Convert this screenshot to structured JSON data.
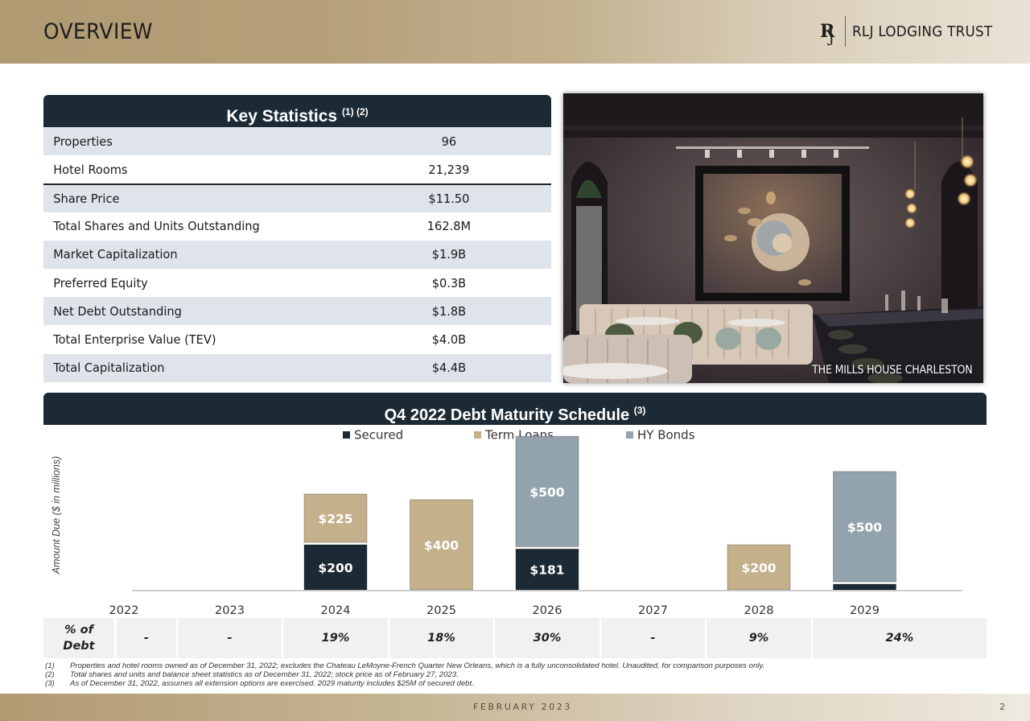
{
  "header": {
    "title": "OVERVIEW",
    "logo_text": "RLJ LODGING TRUST"
  },
  "key_statistics": {
    "title": "Key Statistics",
    "footnote_refs": "(1) (2)",
    "rows": [
      {
        "label": "Properties",
        "value": "96"
      },
      {
        "label": "Hotel Rooms",
        "value": "21,239"
      },
      {
        "label": "Share Price",
        "value": "$11.50"
      },
      {
        "label": "Total Shares and Units Outstanding",
        "value": "162.8M"
      },
      {
        "label": "Market Capitalization",
        "value": "$1.9B"
      },
      {
        "label": "Preferred Equity",
        "value": "$0.3B"
      },
      {
        "label": "Net Debt Outstanding",
        "value": "$1.8B"
      },
      {
        "label": "Total Enterprise Value (TEV)",
        "value": "$4.0B"
      },
      {
        "label": "Total Capitalization",
        "value": "$4.4B"
      }
    ]
  },
  "photo": {
    "caption": "THE MILLS HOUSE CHARLESTON"
  },
  "debt_schedule": {
    "title": "Q4 2022 Debt Maturity Schedule",
    "footnote_ref": "(3)",
    "pct_label_line1": "% of",
    "pct_label_line2": "Debt",
    "pct_of_debt": [
      "-",
      "-",
      "19%",
      "18%",
      "30%",
      "-",
      "9%",
      "24%"
    ]
  },
  "chart_data": {
    "type": "bar",
    "stacked": true,
    "title": "Q4 2022 Debt Maturity Schedule",
    "xlabel": "",
    "ylabel": "Amount Due ($ in millions)",
    "categories": [
      "2022",
      "2023",
      "2024",
      "2025",
      "2026",
      "2027",
      "2028",
      "2029"
    ],
    "series": [
      {
        "name": "Secured",
        "color": "#1b2a35",
        "values": [
          0,
          0,
          200,
          0,
          181,
          0,
          0,
          25
        ]
      },
      {
        "name": "Term Loans",
        "color": "#c4b08a",
        "values": [
          0,
          0,
          225,
          400,
          0,
          0,
          200,
          0
        ]
      },
      {
        "name": "HY Bonds",
        "color": "#93a3ae",
        "values": [
          0,
          0,
          0,
          0,
          500,
          0,
          0,
          500
        ]
      }
    ],
    "data_labels": [
      {
        "category": "2024",
        "series": "Secured",
        "text": "$200"
      },
      {
        "category": "2024",
        "series": "Term Loans",
        "text": "$225"
      },
      {
        "category": "2025",
        "series": "Term Loans",
        "text": "$400"
      },
      {
        "category": "2026",
        "series": "Secured",
        "text": "$181"
      },
      {
        "category": "2026",
        "series": "HY Bonds",
        "text": "$500"
      },
      {
        "category": "2028",
        "series": "Term Loans",
        "text": "$200"
      },
      {
        "category": "2029",
        "series": "HY Bonds",
        "text": "$500"
      }
    ],
    "legend_position": "top-center",
    "grid": false,
    "ylim": [
      0,
      700
    ]
  },
  "footnotes": [
    {
      "num": "(1)",
      "text": "Properties and hotel rooms owned as of December 31, 2022; excludes the Chateau LeMoyne-French Quarter New Orleans, which is a fully unconsolidated hotel. Unaudited, for comparison purposes only."
    },
    {
      "num": "(2)",
      "text": "Total shares and units and balance sheet statistics as of December 31, 2022; stock price as of February 27, 2023."
    },
    {
      "num": "(3)",
      "text": "As of December 31, 2022, assumes all extension options are exercised. 2029 maturity includes $25M of secured debt."
    }
  ],
  "footer": {
    "date": "FEBRUARY 2023",
    "page_number": "2"
  }
}
